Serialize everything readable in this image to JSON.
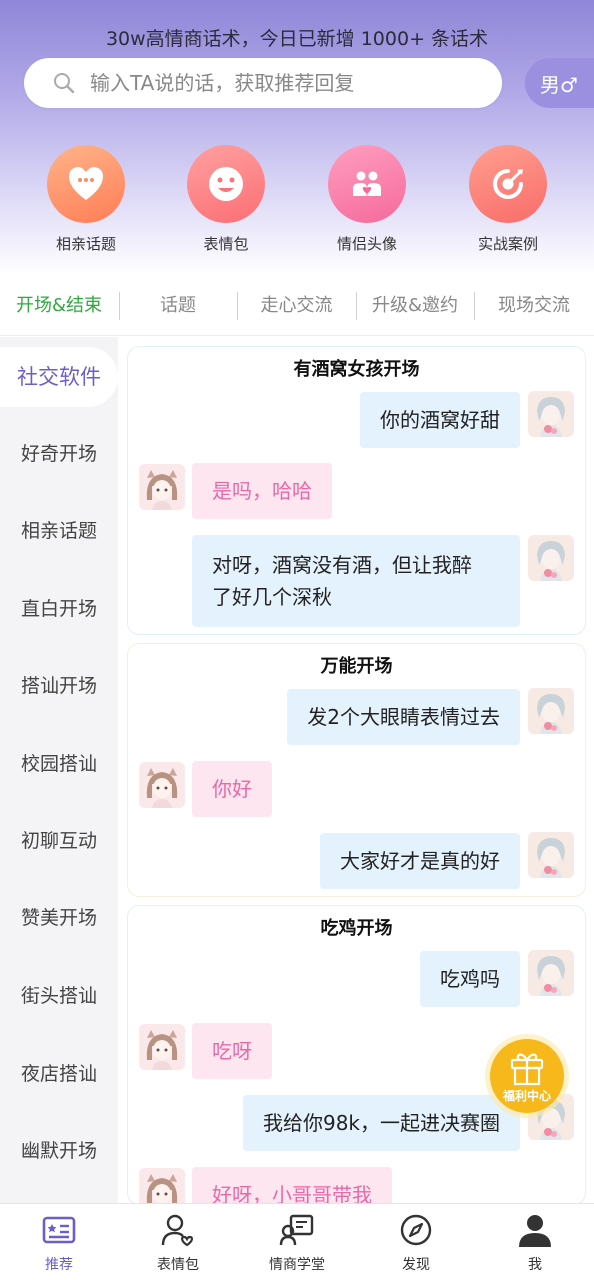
{
  "header": {
    "tagline": "30w高情商话术，今日已新增 1000+ 条话术",
    "search_placeholder": "输入TA说的话，获取推荐回复",
    "gender_label": "男♂"
  },
  "quick_actions": [
    {
      "label": "相亲话题",
      "icon": "chat-heart-icon"
    },
    {
      "label": "表情包",
      "icon": "smiley-icon"
    },
    {
      "label": "情侣头像",
      "icon": "couple-icon"
    },
    {
      "label": "实战案例",
      "icon": "target-icon"
    }
  ],
  "tabs": [
    {
      "label": "开场&结束",
      "active": true
    },
    {
      "label": "话题",
      "active": false
    },
    {
      "label": "走心交流",
      "active": false
    },
    {
      "label": "升级&邀约",
      "active": false
    },
    {
      "label": "现场交流",
      "active": false
    }
  ],
  "sidebar": [
    {
      "label": "社交软件",
      "active": true
    },
    {
      "label": "好奇开场"
    },
    {
      "label": "相亲话题"
    },
    {
      "label": "直白开场"
    },
    {
      "label": "搭讪开场"
    },
    {
      "label": "校园搭讪"
    },
    {
      "label": "初聊互动"
    },
    {
      "label": "赞美开场"
    },
    {
      "label": "街头搭讪"
    },
    {
      "label": "夜店搭讪"
    },
    {
      "label": "幽默开场"
    }
  ],
  "cards": [
    {
      "title": "有酒窝女孩开场",
      "messages": [
        {
          "from": "me",
          "text": "你的酒窝好甜"
        },
        {
          "from": "her",
          "text": "是吗，哈哈"
        },
        {
          "from": "me",
          "line1": "对呀，酒窝没有酒，但让我醉",
          "line2": "了好几个深秋"
        }
      ]
    },
    {
      "title": "万能开场",
      "messages": [
        {
          "from": "me",
          "text": "发2个大眼睛表情过去"
        },
        {
          "from": "her",
          "text": "你好"
        },
        {
          "from": "me",
          "text": "大家好才是真的好"
        }
      ]
    },
    {
      "title": "吃鸡开场",
      "messages": [
        {
          "from": "me",
          "text": "吃鸡吗"
        },
        {
          "from": "her",
          "text": "吃呀"
        },
        {
          "from": "me",
          "text": "我给你98k，一起进决赛圈"
        },
        {
          "from": "her",
          "text": "好呀，小哥哥带我"
        }
      ]
    }
  ],
  "floating": {
    "gift_label": "福利中心"
  },
  "bottom_nav": [
    {
      "label": "推荐",
      "active": true
    },
    {
      "label": "表情包"
    },
    {
      "label": "情商学堂"
    },
    {
      "label": "发现"
    },
    {
      "label": "我"
    }
  ],
  "colors": {
    "accent": "#6a5fc8",
    "tab_active": "#2eaa3c",
    "her_text": "#e869a5"
  }
}
